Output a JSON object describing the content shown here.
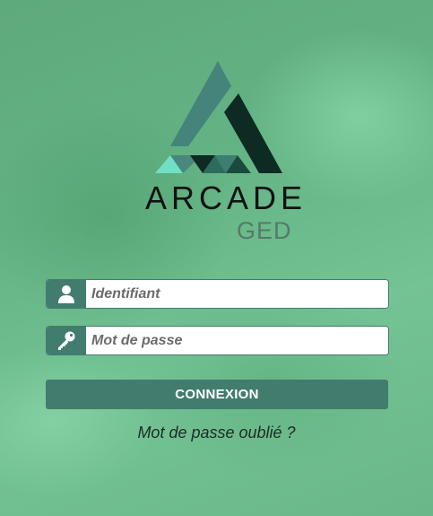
{
  "brand": {
    "name": "ARCADE",
    "subtitle": "GED"
  },
  "login": {
    "username_placeholder": "Identifiant",
    "password_placeholder": "Mot de passe",
    "submit_label": "CONNEXION",
    "forgot_label": "Mot de passe oublié ?"
  },
  "colors": {
    "accent": "#427c6f",
    "logo_dark": "#0d2a23",
    "logo_mid": "#45847a",
    "logo_light": "#6fe0c4"
  },
  "icons": {
    "username": "user-icon",
    "password": "key-icon"
  }
}
